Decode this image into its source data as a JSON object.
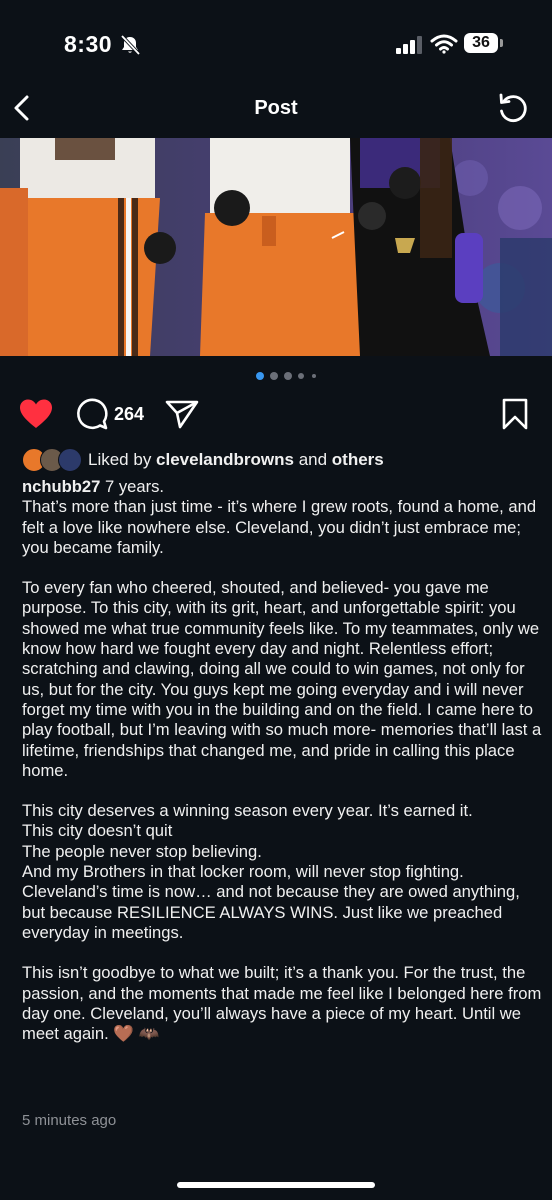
{
  "status_bar": {
    "time": "8:30",
    "battery": "36"
  },
  "nav": {
    "title": "Post"
  },
  "carousel": {
    "total": 5,
    "active_index": 0
  },
  "actions": {
    "comment_count": "264"
  },
  "likes": {
    "prefix": "Liked by ",
    "user": "clevelandbrowns",
    "middle": " and ",
    "others": "others"
  },
  "caption": {
    "username": "nchubb27",
    "first_line": " 7 years.",
    "paragraphs": [
      "That’s more than just time - it’s where I grew roots, found a home, and felt a love like nowhere else. Cleveland, you didn’t just embrace me; you became family.",
      "",
      "To every fan who cheered, shouted, and believed- you gave me purpose. To this city, with its grit, heart, and unforgettable spirit: you showed me what true community feels like. To my teammates, only we know how hard we fought every day and night. Relentless effort; scratching and clawing, doing all we could to win games, not only for us, but for the city. You guys kept me going everyday and i will never forget my time with you in the building and on the field.  I came here to play football, but I’m leaving with so much more- memories that’ll last a lifetime, friendships that changed me, and pride in calling this place home.",
      "",
      "This city deserves a winning season every year. It’s earned it.",
      "This city doesn’t quit",
      "The people never stop believing.",
      "And my Brothers in that locker room, will never stop fighting.",
      "Cleveland’s time is now… and not because they are owed anything, but because RESILIENCE ALWAYS WINS. Just like we preached everyday in meetings.",
      "",
      "This isn’t goodbye to what we built; it’s a thank you. For the trust, the passion, and the moments that made me feel like I belonged here from day one. Cleveland, you’ll always have a piece of my heart. Until we meet again. 🤎 🦇"
    ]
  },
  "timestamp": "5 minutes ago",
  "colors": {
    "background": "#0c1117",
    "like_red": "#ff3040",
    "browns_orange": "#e8782a",
    "browns_brown": "#4a2a17",
    "ravens_purple": "#3b2a7a"
  },
  "icons": {
    "back": "chevron-left-icon",
    "refresh": "refresh-icon",
    "like": "heart-icon",
    "comment": "comment-icon",
    "share": "send-icon",
    "save": "bookmark-icon"
  }
}
